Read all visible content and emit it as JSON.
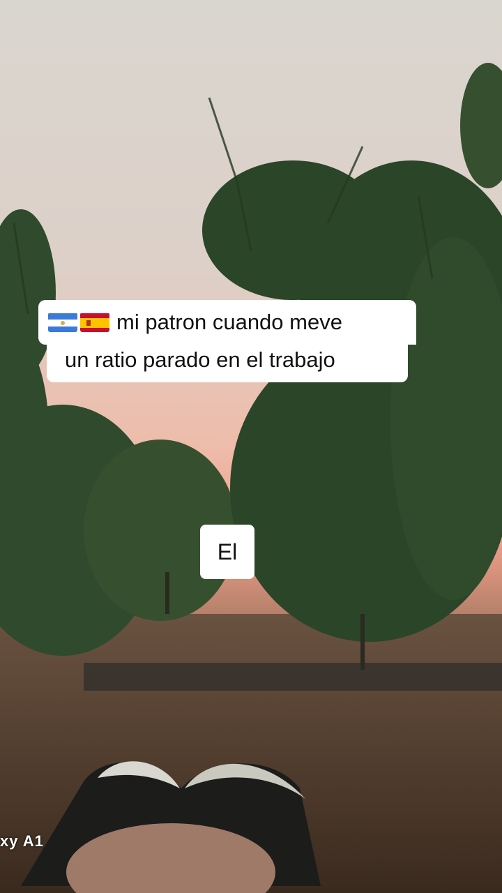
{
  "caption": {
    "flags": [
      "nicaragua-flag",
      "spain-flag"
    ],
    "line1": "mi patron cuando meve",
    "line2": "un ratio parado en el trabajo"
  },
  "overlay_word": "El",
  "watermark": "xy A1",
  "colors": {
    "sky_top": "#d8d4cc",
    "sky_bottom": "#f0b8a8",
    "sun": "#ff3b2a",
    "foliage": "#2e4a2a",
    "ground": "#5a4432"
  }
}
